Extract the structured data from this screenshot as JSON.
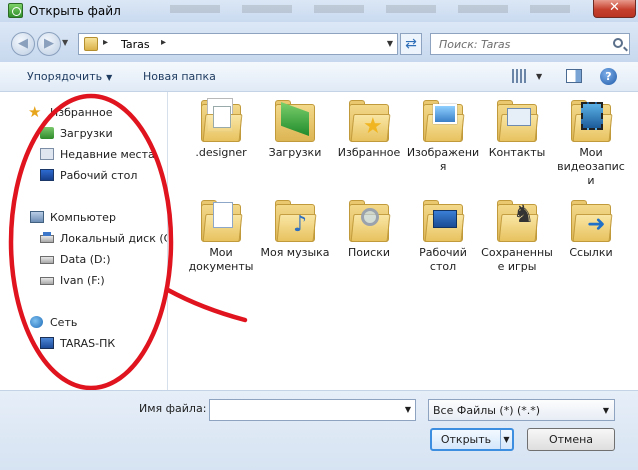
{
  "window": {
    "title": "Открыть файл"
  },
  "nav": {
    "back_glyph": "◀",
    "forward_glyph": "▶",
    "breadcrumb": [
      "Taras"
    ],
    "breadcrumb_sep": "▸",
    "search_placeholder": "Поиск: Taras"
  },
  "toolbar": {
    "organize": "Упорядочить",
    "new_folder": "Новая папка"
  },
  "sidebar": {
    "items": [
      {
        "label": "Избранное",
        "icon": "star-icon"
      },
      {
        "label": "Загрузки",
        "icon": "downloads-icon"
      },
      {
        "label": "Недавние места",
        "icon": "recent-places-icon"
      },
      {
        "label": "Рабочий стол",
        "icon": "desktop-icon"
      },
      {
        "label": "Компьютер",
        "icon": "computer-icon"
      },
      {
        "label": "Локальный диск (C",
        "icon": "system-drive-icon"
      },
      {
        "label": "Data (D:)",
        "icon": "drive-icon"
      },
      {
        "label": "Ivan (F:)",
        "icon": "drive-icon"
      },
      {
        "label": "Сеть",
        "icon": "network-icon"
      },
      {
        "label": "TARAS-ПК",
        "icon": "pc-icon"
      }
    ]
  },
  "files": [
    {
      "name": ".designer",
      "icon": "folder-document-icon"
    },
    {
      "name": "Загрузки",
      "icon": "folder-downloads-icon"
    },
    {
      "name": "Избранное",
      "icon": "folder-favorites-icon"
    },
    {
      "name": "Изображения",
      "icon": "folder-pictures-icon"
    },
    {
      "name": "Контакты",
      "icon": "folder-contacts-icon"
    },
    {
      "name": "Мои видеозаписи",
      "icon": "folder-videos-icon"
    },
    {
      "name": "Мои документы",
      "icon": "folder-documents-icon"
    },
    {
      "name": "Моя музыка",
      "icon": "folder-music-icon"
    },
    {
      "name": "Поиски",
      "icon": "folder-searches-icon"
    },
    {
      "name": "Рабочий стол",
      "icon": "folder-desktop-icon"
    },
    {
      "name": "Сохраненные игры",
      "icon": "folder-games-icon"
    },
    {
      "name": "Ссылки",
      "icon": "folder-links-icon"
    }
  ],
  "bottom": {
    "filename_label": "Имя файла:",
    "filename_value": "",
    "filter_value": "Все Файлы (*) (*.*)",
    "open_label": "Открыть",
    "cancel_label": "Отмена"
  },
  "colors": {
    "annotation": "#e0141e",
    "titlebar": "#c9daf0",
    "close": "#c6402e"
  }
}
